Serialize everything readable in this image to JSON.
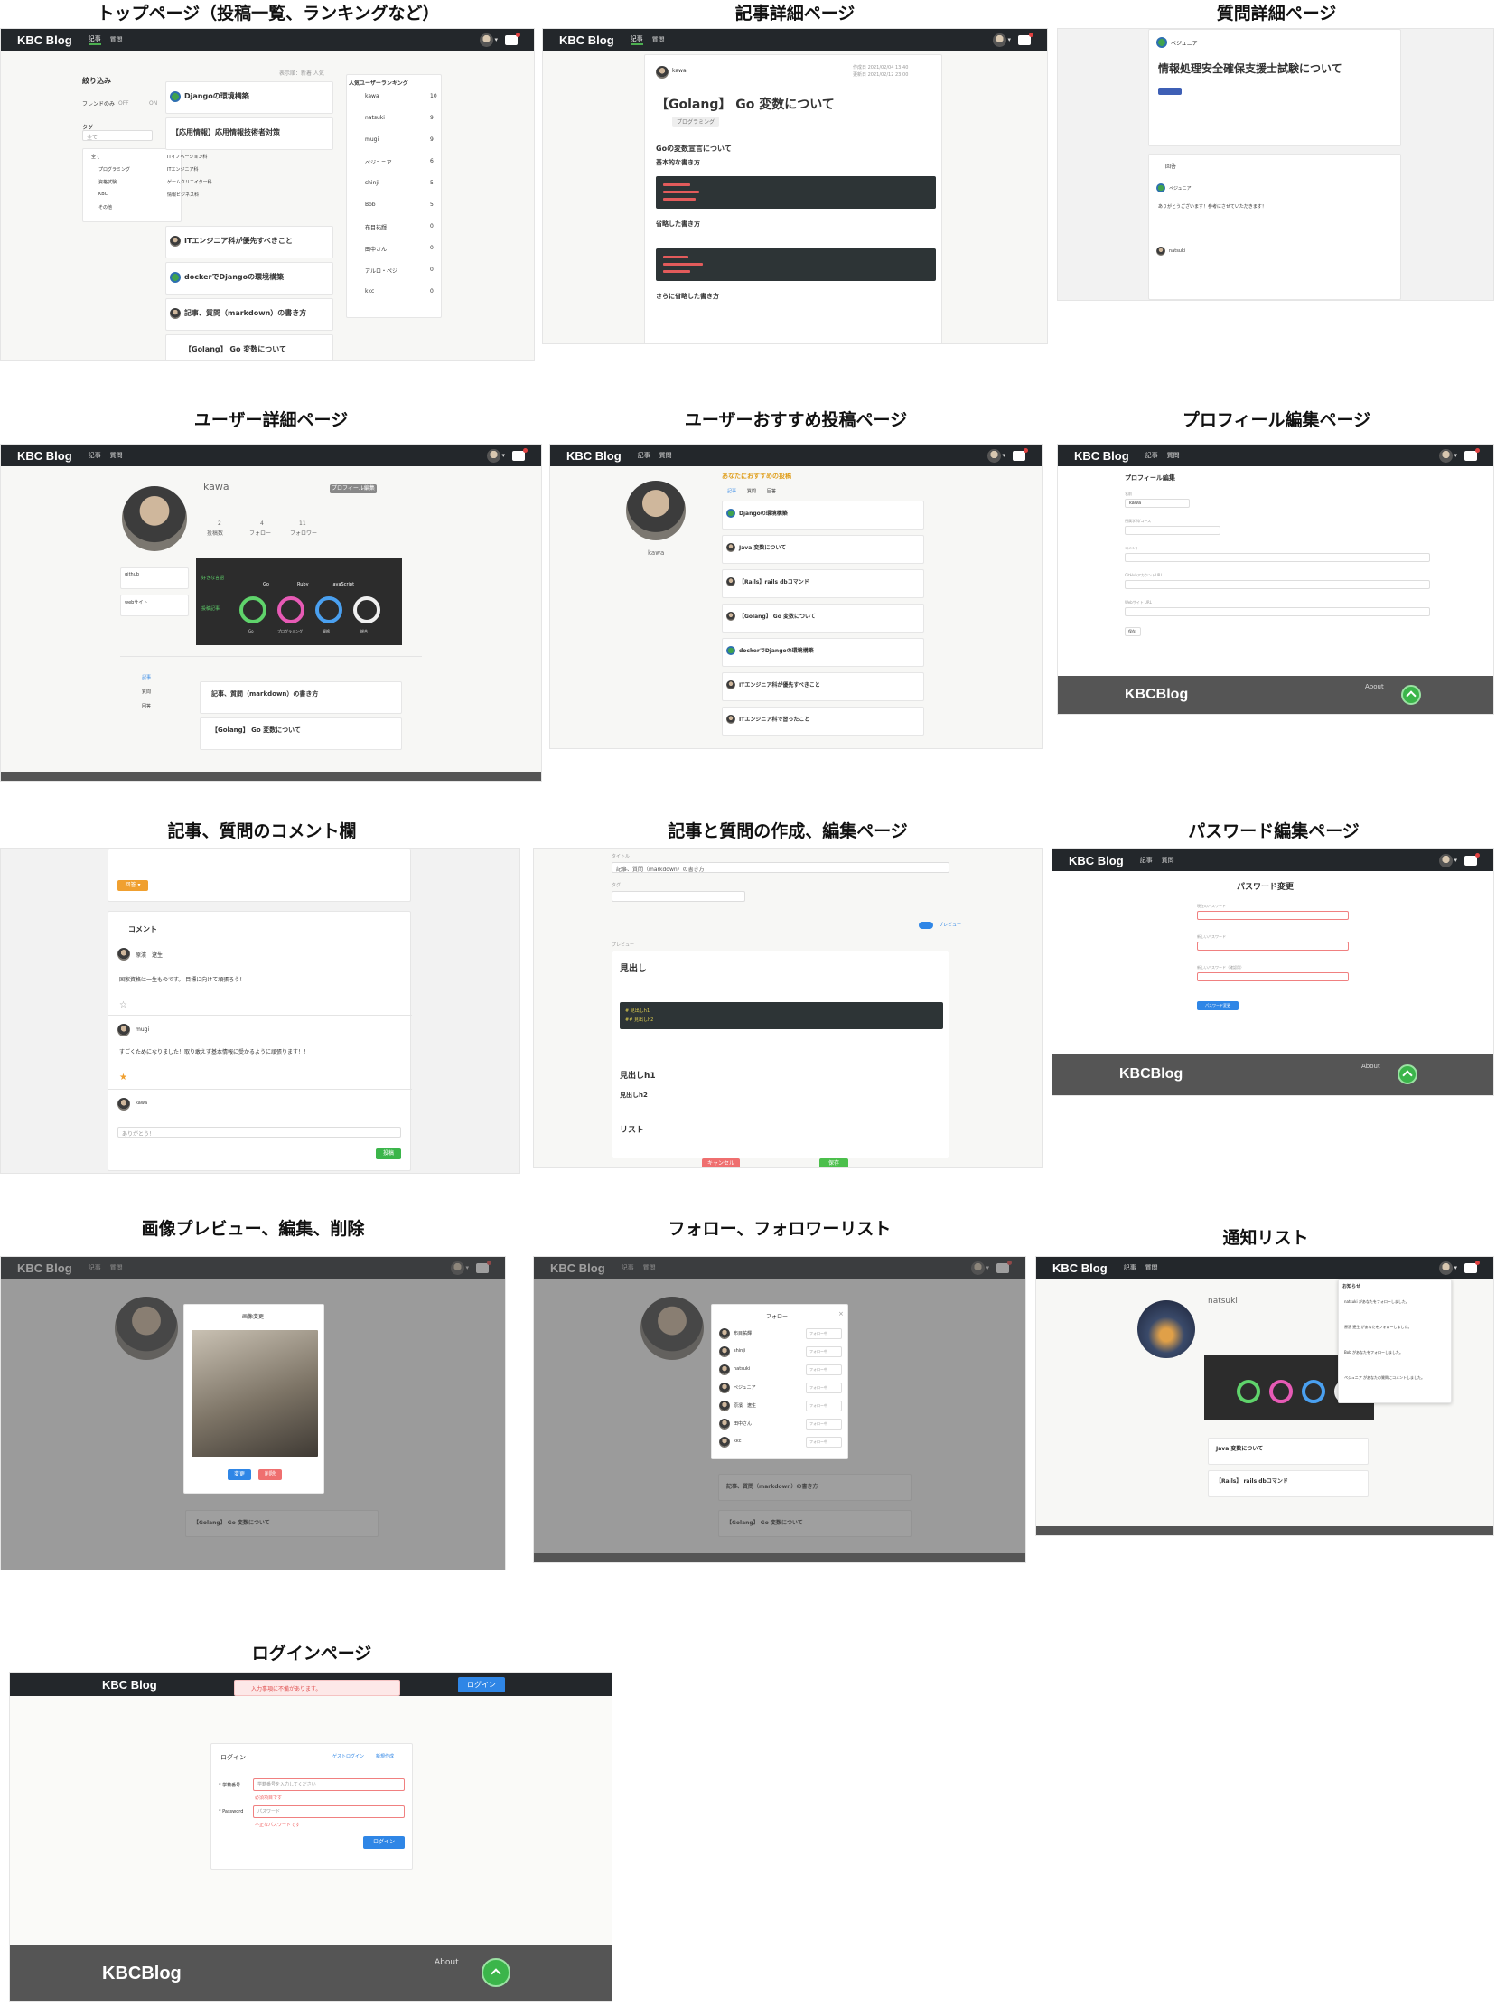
{
  "sections": {
    "top": "トップページ（投稿一覧、ランキングなど）",
    "article": "記事詳細ページ",
    "question": "質問詳細ページ",
    "user": "ユーザー詳細ページ",
    "recommend": "ユーザーおすすめ投稿ページ",
    "profile": "プロフィール編集ページ",
    "comment": "記事、質問のコメント欄",
    "editor": "記事と質問の作成、編集ページ",
    "password": "パスワード編集ページ",
    "image": "画像プレビュー、編集、削除",
    "follow": "フォロー、フォロワーリスト",
    "notice": "通知リスト",
    "login": "ログインページ"
  },
  "nav": {
    "logo": "KBC Blog",
    "tab_articles": "記事",
    "tab_questions": "質問",
    "post": "投稿 ▾",
    "login": "ログイン"
  },
  "top": {
    "filter": "絞り込み",
    "friends_only": "フレンドのみ",
    "off": "OFF",
    "on": "ON",
    "tag": "タグ",
    "tag_all": "全て",
    "sort": "表示順：新着 人気",
    "menu": [
      "全て",
      "プログラミング",
      "資格試験",
      "KBC",
      "その他"
    ],
    "submenu": [
      "ITイノベーション科",
      "ITエンジニア科",
      "ゲームクリエイター科",
      "情報ビジネス科"
    ],
    "posts": [
      "Djangoの環境構築",
      "【応用情報】応用情報技術者対策",
      "ITエンジニア科が優先すべきこと",
      "dockerでDjangoの環境構築",
      "記事、質問（markdown）の書き方",
      "【Golang】 Go 変数について"
    ],
    "ranking_title": "人気ユーザーランキング",
    "ranking": [
      {
        "name": "kawa",
        "score": "10"
      },
      {
        "name": "natsuki",
        "score": "9"
      },
      {
        "name": "mugi",
        "score": "9"
      },
      {
        "name": "ペジュニア",
        "score": "6"
      },
      {
        "name": "shinji",
        "score": "5"
      },
      {
        "name": "Bob",
        "score": "5"
      },
      {
        "name": "布目祐輝",
        "score": "0"
      },
      {
        "name": "田中さん",
        "score": "0"
      },
      {
        "name": "アルロ・ペジ",
        "score": "0"
      },
      {
        "name": "kkc",
        "score": "0"
      }
    ]
  },
  "article": {
    "author": "kawa",
    "title": "【Golang】 Go 変数について",
    "tag": "プログラミング",
    "h1": "Goの変数宣言について",
    "h2": "基本的な書き方",
    "h3": "省略した書き方",
    "h4": "さらに省略した書き方",
    "date1": "作成日 2021/02/04 13:40",
    "date2": "更新日 2021/02/12 23:00"
  },
  "question": {
    "author": "ペジュニア",
    "title": "情報処理安全確保支援士試験について",
    "answers": "回答",
    "reply": "ありがとうございます！参考にさせていただきます！",
    "user2": "natsuki"
  },
  "user": {
    "name": "kawa",
    "profile_btn": "プロフィール編集",
    "posts": "投稿数",
    "follow": "フォロー",
    "follower": "フォロワー",
    "n_posts": "2",
    "n_follow": "4",
    "n_follower": "11",
    "github": "github",
    "website": "webサイト",
    "fav_lang": "好きな言語",
    "langs": [
      "Go",
      "Ruby",
      "JavaScript"
    ],
    "fields": "投稿記事",
    "side": [
      "記事",
      "質問",
      "回答"
    ],
    "posts_list": [
      "記事、質問（markdown）の書き方",
      "【Golang】 Go 変数について"
    ],
    "rings": [
      "Go",
      "プログラミング",
      "資格",
      "総合"
    ]
  },
  "recommend": {
    "heading": "あなたにおすすめの投稿",
    "tabs": [
      "記事",
      "質問",
      "回答"
    ],
    "posts": [
      "Djangoの環境構築",
      "Java 変数について",
      "【Rails】rails dbコマンド",
      "【Golang】 Go 変数について",
      "dockerでDjangoの環境構築",
      "ITエンジニア科が優先すべきこと",
      "ITエンジニア科で習ったこと"
    ]
  },
  "profile": {
    "heading": "プロフィール編集",
    "fields": [
      "名前",
      "所属学科/コース",
      "コメント",
      "GitHubアカウントURL",
      "Webサイト URL"
    ],
    "save": "保存"
  },
  "footer": {
    "logo": "KBCBlog",
    "about": "About"
  },
  "comment": {
    "btn": "回答 ▾",
    "heading": "コメント",
    "u1": "原濱　遼生",
    "c1": "国家資格は一生ものです。 目標に向けて頑張ろう！",
    "u2": "mugi",
    "c2": "すごくためになりました！取り敢えず基本情報に受かるように頑張ります！！",
    "u3": "kawa",
    "placeholder": "ありがとう！",
    "submit": "投稿"
  },
  "editor": {
    "title_label": "タイトル",
    "title_value": "記事、質問（markdown）の書き方",
    "tag_label": "タグ",
    "preview": "プレビュー",
    "switch": "プレビュー",
    "h": [
      "見出し",
      "見出しh1",
      "見出しh2",
      "リスト"
    ],
    "code1": "# 見出しh1",
    "code2": "## 見出しh2",
    "cancel": "キャンセル",
    "save": "保存"
  },
  "password": {
    "heading": "パスワード変更",
    "current": "現在のパスワード",
    "new": "新しいパスワード",
    "confirm": "新しいパスワード（確認用）",
    "btn": "パスワード変更"
  },
  "image": {
    "heading": "画像変更",
    "ok": "変更",
    "del": "削除"
  },
  "follow": {
    "heading": "フォロー",
    "users": [
      "布目祐輝",
      "shinji",
      "natsuki",
      "ペジュニア",
      "原濱　遼生",
      "田中さん",
      "kkc"
    ],
    "btn": "フォロー中"
  },
  "notice": {
    "user": "natsuki",
    "heading": "お知らせ",
    "items": [
      "natsuki があなたをフォローしました。",
      "原濱 遼生 があなたをフォローしました。",
      "Bob があなたをフォローしました。",
      "ペジュニア があなたの質問にコメントしました。"
    ],
    "posts": [
      "Java 変数について",
      "【Rails】 rails dbコマンド"
    ]
  },
  "login": {
    "alert": "入力事項に不備があります。",
    "heading": "ログイン",
    "guest": "ゲストログイン",
    "signup": "新規作成",
    "mail": "* 学籍番号",
    "pass": "* Password",
    "mail_ph": "学籍番号を入力してください",
    "pass_ph": "パスワード",
    "err1": "必須項目です",
    "err2": "不正なパスワードです",
    "submit": "ログイン"
  },
  "colors": {
    "nav": "#23272b",
    "accent": "#4caf50",
    "footer": "#555555",
    "primary": "#2f86e6"
  }
}
